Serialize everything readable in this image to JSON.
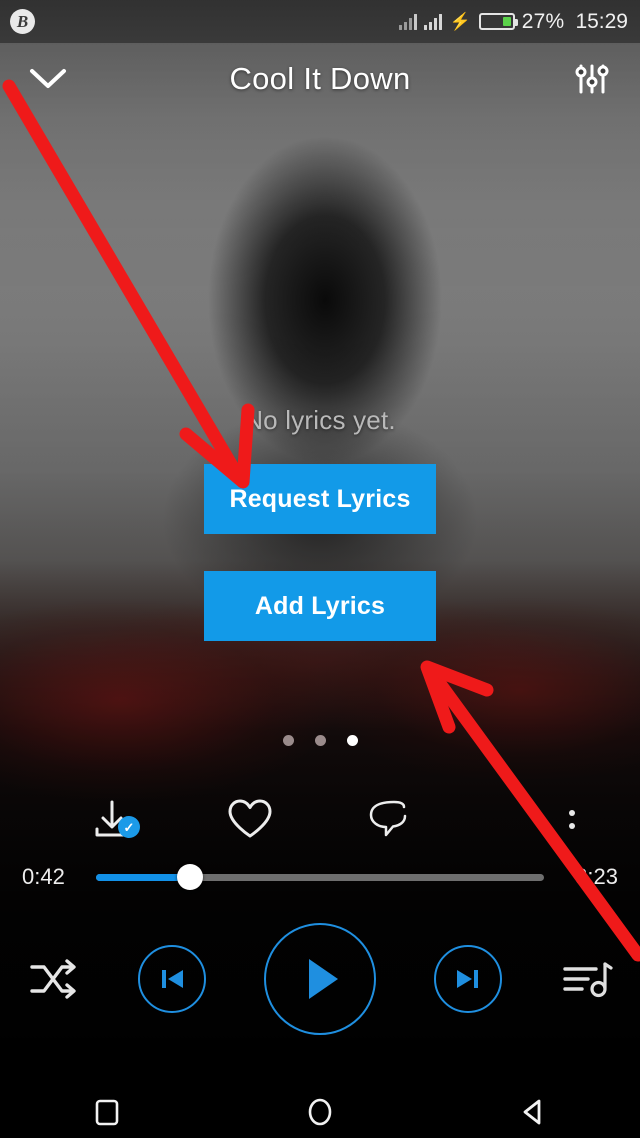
{
  "status_bar": {
    "app_icon": "app-badge-icon",
    "app_icon_glyph": "B",
    "signal_1": "signal-bars-icon",
    "signal_2": "signal-bars-icon",
    "charging": "charging-bolt-icon",
    "battery_icon": "battery-icon",
    "battery_percent": "27%",
    "battery_level": 27,
    "time": "15:29"
  },
  "header": {
    "collapse_icon": "chevron-down-icon",
    "title": "Cool It Down",
    "equalizer_icon": "equalizer-sliders-icon"
  },
  "lyrics": {
    "empty_message": "No lyrics yet.",
    "request_button": "Request Lyrics",
    "add_button": "Add Lyrics"
  },
  "pager": {
    "total": 3,
    "active_index": 2
  },
  "actions": {
    "download": {
      "name": "download-complete-icon",
      "badge": "✓"
    },
    "favorite": {
      "name": "heart-outline-icon"
    },
    "comment": {
      "name": "comment-bubble-icon"
    },
    "more": {
      "name": "overflow-menu-icon"
    }
  },
  "playback": {
    "current_time": "0:42",
    "total_time": "3:23",
    "progress_percent": 21,
    "shuffle_icon": "shuffle-icon",
    "previous_icon": "skip-previous-icon",
    "play_icon": "play-icon",
    "next_icon": "skip-next-icon",
    "queue_icon": "playlist-queue-icon"
  },
  "nav_bar": {
    "recents": "recents-square-icon",
    "home": "home-circle-icon",
    "back": "back-triangle-icon"
  },
  "annotations": {
    "arrow_1": "red-arrow-pointing-to-request-lyrics",
    "arrow_2": "red-arrow-pointing-to-add-lyrics",
    "color": "#ef1a1a"
  },
  "colors": {
    "accent_blue": "#129ae8",
    "progress_blue": "#1291e8",
    "control_outline": "#1f8fe0",
    "battery_green": "#5bd24a"
  }
}
